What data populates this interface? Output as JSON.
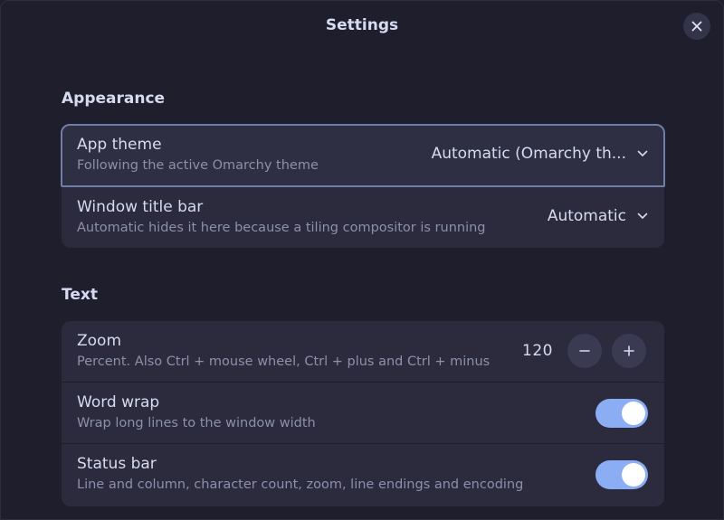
{
  "window": {
    "title": "Settings"
  },
  "appearance": {
    "title": "Appearance",
    "app_theme": {
      "label": "App theme",
      "description": "Following the active Omarchy theme",
      "value": "Automatic (Omarchy th..."
    },
    "window_title_bar": {
      "label": "Window title bar",
      "description": "Automatic hides it here because a tiling compositor is running",
      "value": "Automatic"
    }
  },
  "text": {
    "title": "Text",
    "zoom": {
      "label": "Zoom",
      "description": "Percent. Also Ctrl + mouse wheel, Ctrl + plus and Ctrl + minus",
      "value": "120"
    },
    "word_wrap": {
      "label": "Word wrap",
      "description": "Wrap long lines to the window width",
      "enabled": true
    },
    "status_bar": {
      "label": "Status bar",
      "description": "Line and column, character count, zoom, line endings and encoding",
      "enabled": true
    }
  },
  "colors": {
    "accent": "#8aadf4",
    "background": "#1e1e2c",
    "card": "#2b2b3d"
  }
}
